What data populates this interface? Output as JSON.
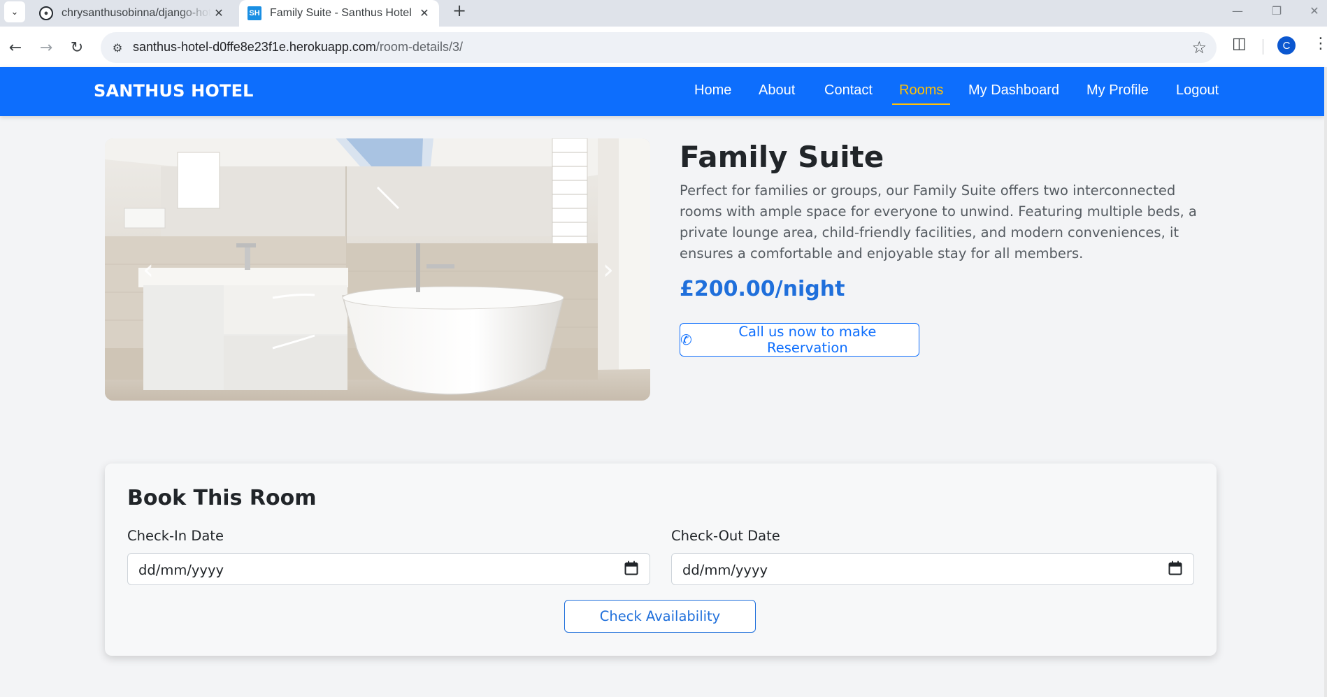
{
  "browser": {
    "tabs": [
      {
        "title": "chrysanthusobinna/django-hotel",
        "favicon": "github-icon",
        "active": false
      },
      {
        "title": "Family Suite - Santhus Hotel",
        "favicon": "SH",
        "active": true
      }
    ],
    "new_tab_symbol": "+",
    "url_host": "santhus-hotel-d0ffe8e23f1e.herokuapp.com",
    "url_path": "/room-details/3/",
    "profile_initial": "C"
  },
  "site": {
    "brand": "SANTHUS HOTEL",
    "nav": [
      {
        "label": "Home",
        "active": false
      },
      {
        "label": "About",
        "active": false
      },
      {
        "label": "Contact",
        "active": false
      },
      {
        "label": "Rooms",
        "active": true
      },
      {
        "label": "My Dashboard",
        "active": false
      },
      {
        "label": "My Profile",
        "active": false
      },
      {
        "label": "Logout",
        "active": false
      }
    ],
    "colors": {
      "nav_bg": "#0d6efd",
      "active_link": "#ffc107",
      "price": "#1f6fdb"
    }
  },
  "room": {
    "title": "Family Suite",
    "description": "Perfect for families or groups, our Family Suite offers two interconnected rooms with ample space for everyone to unwind. Featuring multiple beds, a private lounge area, child-friendly facilities, and modern conveniences, it ensures a comfortable and enjoyable stay for all members.",
    "price": "£200.00/night",
    "call_button": "Call us now to make Reservation"
  },
  "booking": {
    "heading": "Book This Room",
    "check_in_label": "Check-In Date",
    "check_out_label": "Check-Out Date",
    "check_in_value": "dd/mm/yyyy",
    "check_out_value": "dd/mm/yyyy",
    "submit_label": "Check Availability"
  }
}
